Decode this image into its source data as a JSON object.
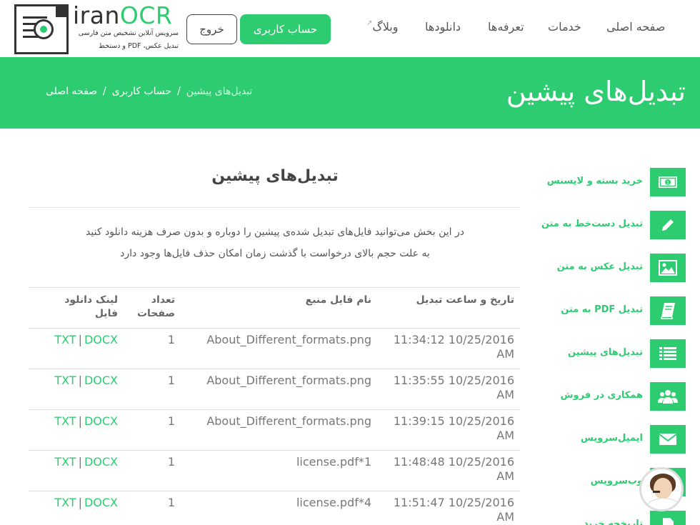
{
  "header": {
    "logo": {
      "name_part1": "iran",
      "name_part2": "OCR",
      "tagline1": "سرویس آنلاین تشخیص متن فارسی",
      "tagline2": "تبدیل عکس، PDF و دستخط"
    },
    "logout_label": "خروج",
    "account_label": "حساب کاربری",
    "nav": {
      "home": "صفحه اصلی",
      "services": "خدمات",
      "pricing": "تعرفه‌ها",
      "downloads": "دانلودها",
      "blog": "وبلاگ"
    }
  },
  "banner": {
    "title": "تبدیل‌های پیشین",
    "breadcrumb": {
      "home": "صفحه اصلی",
      "account": "حساب کاربری",
      "current": "تبدیل‌های پیشین"
    }
  },
  "sidebar": {
    "items": [
      {
        "label": "خرید بسته و لایسنس",
        "icon": "money-icon"
      },
      {
        "label": "تبدیل دست‌خط به متن",
        "icon": "pencil-icon"
      },
      {
        "label": "تبدیل عکس به متن",
        "icon": "image-icon"
      },
      {
        "label": "تبدیل PDF به متن",
        "icon": "book-icon"
      },
      {
        "label": "تبدیل‌های پیشین",
        "icon": "list-icon"
      },
      {
        "label": "همکاری در فروش",
        "icon": "users-icon"
      },
      {
        "label": "ایمیل‌سرویس",
        "icon": "envelope-icon"
      },
      {
        "label": "وب‌سرویس",
        "icon": "code-icon"
      },
      {
        "label": "تاریخچه خرید",
        "icon": "file-icon"
      }
    ]
  },
  "main": {
    "title": "تبدیل‌های پیشین",
    "description_line1": "در این بخش می‌توانید فایل‌های تبدیل شده‌ی پیشین را دوباره و بدون صرف هزینه دانلود کنید",
    "description_line2": "به علت حجم بالای درخواست با گذشت زمان امکان حذف فایل‌ها وجود دارد",
    "table": {
      "headers": {
        "datetime": "تاریخ و ساعت تبدیل",
        "filename": "نام فایل منبع",
        "pages": "تعداد صفحات",
        "download": "لینک دانلود فایل"
      },
      "docx_label": "DOCX",
      "txt_label": "TXT",
      "rows": [
        {
          "datetime": "11:34:12 10/25/2016 AM",
          "filename": "About_Different_formats.png",
          "pages": "1"
        },
        {
          "datetime": "11:35:55 10/25/2016 AM",
          "filename": "About_Different_formats.png",
          "pages": "1"
        },
        {
          "datetime": "11:39:15 10/25/2016 AM",
          "filename": "About_Different_formats.png",
          "pages": "1"
        },
        {
          "datetime": "11:48:48 10/25/2016 AM",
          "filename": "license.pdf*1",
          "pages": "1"
        },
        {
          "datetime": "11:51:47 10/25/2016 AM",
          "filename": "license.pdf*4",
          "pages": "1"
        }
      ]
    }
  },
  "colors": {
    "accent": "#2ecc71",
    "text": "#555555"
  }
}
